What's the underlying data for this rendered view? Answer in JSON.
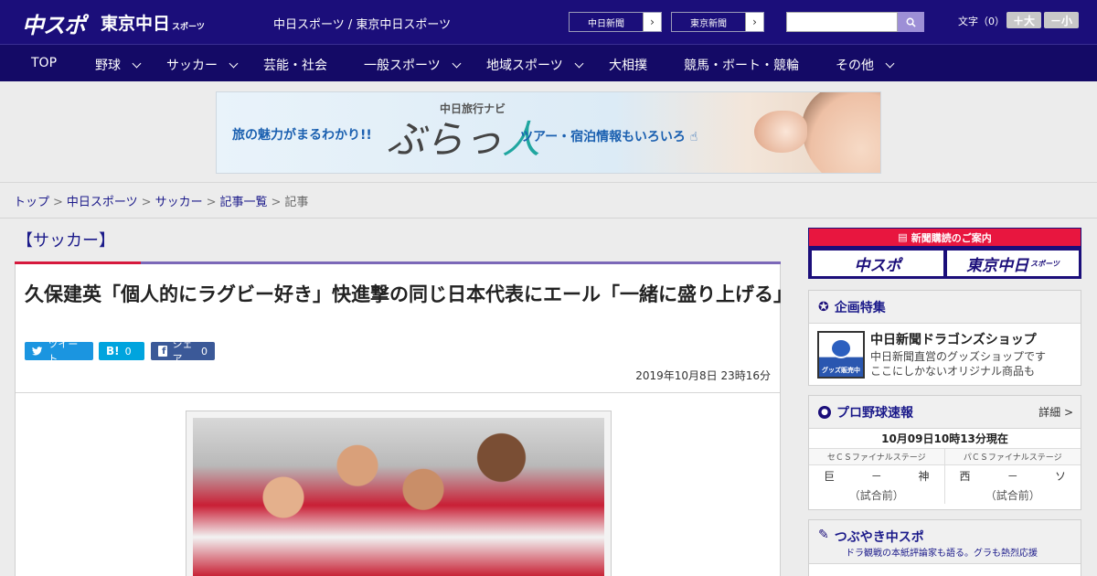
{
  "header": {
    "logo_main": "中スポ",
    "logo_tokyo": "東京中日",
    "logo_tokyo_sub": "スポーツ",
    "site_name": "中日スポーツ / 東京中日スポーツ",
    "link_chunichi": "中日新聞",
    "link_tokyo": "東京新聞",
    "search_placeholder": "",
    "font_size_label": "文字（0）",
    "font_bigger": "＋大",
    "font_smaller": "－小"
  },
  "nav": {
    "items": [
      {
        "label": "TOP",
        "dropdown": false
      },
      {
        "label": "野球",
        "dropdown": true
      },
      {
        "label": "サッカー",
        "dropdown": true
      },
      {
        "label": "芸能・社会",
        "dropdown": false
      },
      {
        "label": "一般スポーツ",
        "dropdown": true
      },
      {
        "label": "地域スポーツ",
        "dropdown": true
      },
      {
        "label": "大相撲",
        "dropdown": false
      },
      {
        "label": "競馬・ボート・競輪",
        "dropdown": false
      },
      {
        "label": "その他",
        "dropdown": true
      }
    ]
  },
  "banner": {
    "lead": "旅の魅力がまるわかり!!",
    "small_title": "中日旅行ナビ",
    "big_title_a": "ぶらっ",
    "big_title_b": "人",
    "right_text": "ツアー・宿泊情報もいろいろ"
  },
  "breadcrumb": {
    "items": [
      "トップ",
      "中日スポーツ",
      "サッカー",
      "記事一覧"
    ],
    "current": "記事"
  },
  "article": {
    "category": "【サッカー】",
    "headline": "久保建英「個人的にラグビー好き」快進撃の同じ日本代表にエール「一緒に盛り上げる」",
    "tweet_label": "ツイート",
    "hatena_label": "B!",
    "hatena_count": "0",
    "share_label": "シェア",
    "share_count": "0",
    "date": "2019年10月8日 23時16分"
  },
  "sidebar": {
    "subscribe_head": "新聞購読のご案内",
    "subscribe_logo1": "中スポ",
    "subscribe_logo2": "東京中日",
    "subscribe_logo2_sub": "スポーツ",
    "feature_title": "企画特集",
    "shop_thumb_caption": "グッズ販売中",
    "shop_title": "中日新聞ドラゴンズショップ",
    "shop_desc1": "中日新聞直営のグッズショップです",
    "shop_desc2": "ここにしかないオリジナル商品も",
    "baseball_title": "プロ野球速報",
    "baseball_more": "詳細 >",
    "baseball_time": "10月09日10時13分現在",
    "games": [
      {
        "stage": "セＣＳファイナルステージ",
        "home": "巨",
        "dash": "－",
        "away": "神",
        "status": "（試合前）"
      },
      {
        "stage": "パＣＳファイナルステージ",
        "home": "西",
        "dash": "－",
        "away": "ソ",
        "status": "（試合前）"
      }
    ],
    "tweet_title": "つぶやき中スポ",
    "tweet_sub": "ドラ観戦の本紙評論家も語る。グラも熱烈応援"
  },
  "colors": {
    "header_bg": "#1b0e7a",
    "nav_bg": "#140a66",
    "accent_red": "#d6193d",
    "link": "#1b1a8a"
  }
}
